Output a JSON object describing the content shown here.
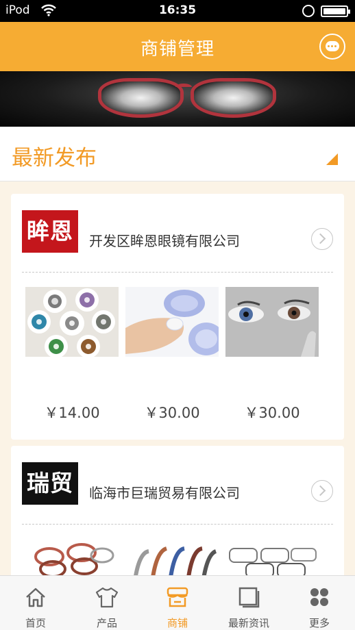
{
  "status_bar": {
    "carrier": "iPod",
    "time": "16:35"
  },
  "header": {
    "title": "商铺管理"
  },
  "section": {
    "title": "最新发布"
  },
  "shops": [
    {
      "logo_text": "眸恩",
      "logo_color": "#c4161c",
      "name": "开发区眸恩眼镜有限公司",
      "products": [
        {
          "image": "colored-contact-lenses",
          "price": "￥14.00"
        },
        {
          "image": "contact-lens-case",
          "price": "￥30.00"
        },
        {
          "image": "eye-contact-lens",
          "price": "￥30.00"
        }
      ]
    },
    {
      "logo_text": "瑞贸",
      "logo_color": "#111111",
      "name": "临海市巨瑞贸易有限公司",
      "products": [
        {
          "image": "eyeglass-frames"
        },
        {
          "image": "eyeglass-frames-colorful"
        },
        {
          "image": "eyeglass-frames-metal"
        }
      ]
    }
  ],
  "tabs": [
    {
      "label": "首页",
      "icon": "home-icon"
    },
    {
      "label": "产品",
      "icon": "tshirt-icon"
    },
    {
      "label": "商铺",
      "icon": "store-icon",
      "active": true
    },
    {
      "label": "最新资讯",
      "icon": "news-icon"
    },
    {
      "label": "更多",
      "icon": "grid-icon"
    }
  ],
  "colors": {
    "accent": "#f6ac33",
    "accent_text": "#f29a25"
  }
}
